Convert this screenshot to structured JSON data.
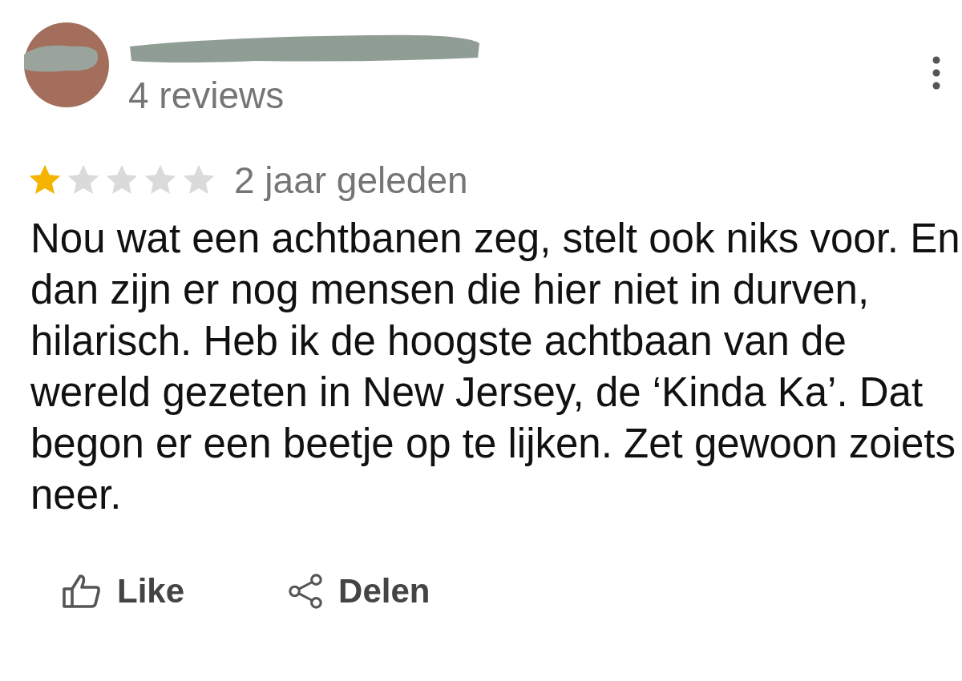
{
  "author": {
    "reviews": "4 reviews"
  },
  "rating": {
    "stars": 1
  },
  "time": "2 jaar geleden",
  "text": "Nou wat een achtbanen zeg, stelt ook niks voor. En dan zijn er nog mensen die hier niet in durven, hilarisch. Heb ik de hoogste achtbaan van de wereld gezeten in New Jersey, de ‘Kinda Ka’. Dat begon er een beetje op te lijken. Zet gewoon zoiets neer.",
  "actions": [
    {
      "kind": "like",
      "label": "Like"
    },
    {
      "kind": "share",
      "label": "Delen"
    }
  ]
}
